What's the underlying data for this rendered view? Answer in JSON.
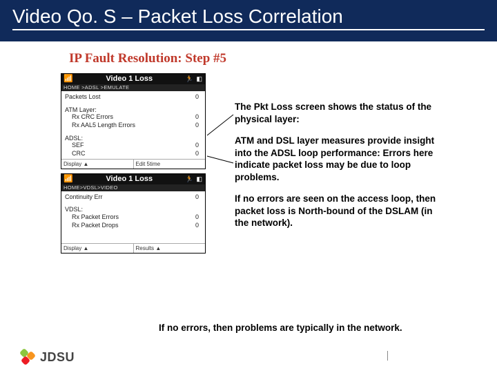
{
  "title": "Video Qo. S – Packet Loss Correlation",
  "subtitle": "IP Fault Resolution: Step #5",
  "shot1": {
    "title": "Video 1 Loss",
    "breadcrumb": "HOME >ADSL >EMULATE",
    "packets_lost_label": "Packets Lost",
    "packets_lost_val": "0",
    "atm_header": "ATM Layer:",
    "atm_crc_label": "Rx CRC Errors",
    "atm_crc_val": "0",
    "atm_aal5_label": "Rx AAL5 Length Errors",
    "atm_aal5_val": "0",
    "adsl_header": "ADSL:",
    "adsl_sef_label": "SEF",
    "adsl_sef_val": "0",
    "adsl_crc_label": "CRC",
    "adsl_crc_val": "0",
    "footer_left": "Display ▲",
    "footer_right": "Edit  5time"
  },
  "shot2": {
    "title": "Video 1 Loss",
    "breadcrumb": "HOME>VDSL>VIDEO",
    "cont_label": "Continuity Err",
    "cont_val": "0",
    "vdsl_header": "VDSL:",
    "vdsl_pe_label": "Rx Packet Errors",
    "vdsl_pe_val": "0",
    "vdsl_pd_label": "Rx Packet Drops",
    "vdsl_pd_val": "0",
    "footer_left": "Display ▲",
    "footer_right": "Results ▲"
  },
  "explain": {
    "p1": "The Pkt Loss screen shows the status of the physical layer:",
    "p2": "ATM and DSL layer measures provide insight into the ADSL loop performance:  Errors here indicate packet loss may be due to loop problems.",
    "p3": "If no errors are seen on the access loop, then packet loss is North-bound of the DSLAM (in the network)."
  },
  "bottom": "If no errors, then problems are typically in the network.",
  "logo_text": "JDSU"
}
